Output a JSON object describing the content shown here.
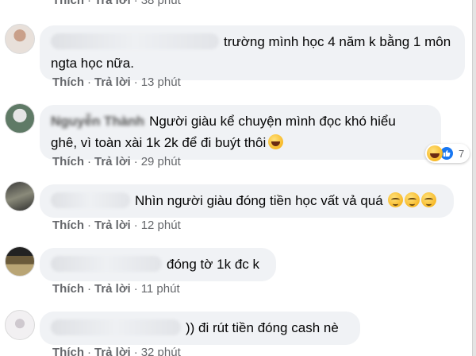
{
  "colors": {
    "bubble": "#f0f2f5",
    "meta": "#65676b",
    "text": "#050505",
    "like_blue": "#1877f2"
  },
  "top_partial": {
    "like": "Thích",
    "dot": "·",
    "reply": "Trả lời",
    "time": "38 phút"
  },
  "comments": [
    {
      "line1": "trường mình học 4 năm k bằng 1 môn",
      "line2": "ngta học nữa.",
      "like": "Thích",
      "dot": "·",
      "reply": "Trả lời",
      "time": "13 phút"
    },
    {
      "name": "Nguyễn Thành",
      "line1": "Người giàu kể chuyện mình đọc khó hiểu",
      "line2": "ghê, vì toàn xài 1k 2k để đi buýt thôi",
      "like": "Thích",
      "dot": "·",
      "reply": "Trả lời",
      "time": "29 phút",
      "reaction_icons": [
        "haha-icon",
        "like-icon"
      ],
      "reaction_count": "7"
    },
    {
      "line1": "Nhìn người giàu đóng tiền học vất vả quá",
      "like": "Thích",
      "dot": "·",
      "reply": "Trả lời",
      "time": "12 phút"
    },
    {
      "line1": "đóng tờ 1k đc k",
      "like": "Thích",
      "dot": "·",
      "reply": "Trả lời",
      "time": "11 phút"
    },
    {
      "line1": ")) đi rút tiền đóng cash nè",
      "like": "Thích",
      "dot": "·",
      "reply": "Trả lời",
      "time": "32 phút"
    }
  ]
}
